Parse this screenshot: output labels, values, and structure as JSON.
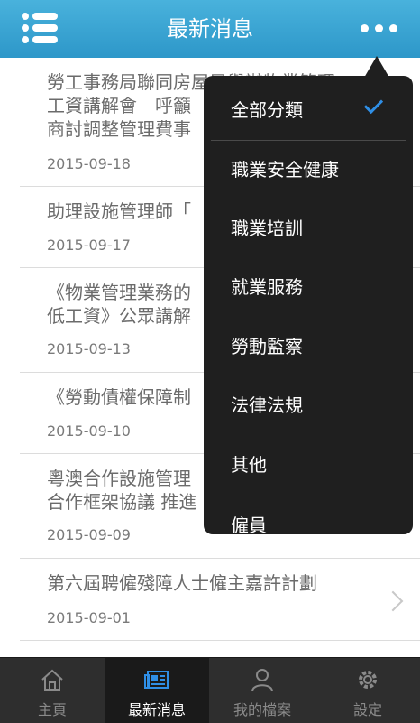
{
  "header": {
    "title": "最新消息",
    "menu_icon": "list-menu-icon",
    "more_icon": "more-dots-icon",
    "color": "#3aa6d6"
  },
  "news": [
    {
      "title": "勞工事務局聯同房屋局舉辦物業管理\n工資講解會　呼籲\n商討調整管理費事",
      "date": "2015-09-18"
    },
    {
      "title": "助理設施管理師「",
      "date": "2015-09-17"
    },
    {
      "title": "《物業管理業務的\n低工資》公眾講解",
      "date": "2015-09-13"
    },
    {
      "title": "《勞動債權保障制",
      "date": "2015-09-10"
    },
    {
      "title": "粵澳合作設施管理\n合作框架協議 推進",
      "date": "2015-09-09"
    },
    {
      "title": "第六屆聘僱殘障人士僱主嘉許計劃",
      "date": "2015-09-01"
    }
  ],
  "dropdown": {
    "items": [
      {
        "label": "全部分類",
        "selected": true
      },
      {
        "label": "職業安全健康",
        "selected": false
      },
      {
        "label": "職業培訓",
        "selected": false
      },
      {
        "label": "就業服務",
        "selected": false
      },
      {
        "label": "勞動監察",
        "selected": false
      },
      {
        "label": "法律法規",
        "selected": false
      },
      {
        "label": "其他",
        "selected": false
      },
      {
        "label": "僱員",
        "selected": false
      }
    ],
    "accent": "#2f8fe6"
  },
  "tabbar": {
    "tabs": [
      {
        "label": "主頁",
        "icon": "home-icon",
        "active": false
      },
      {
        "label": "最新消息",
        "icon": "news-icon",
        "active": true
      },
      {
        "label": "我的檔案",
        "icon": "person-icon",
        "active": false
      },
      {
        "label": "設定",
        "icon": "gear-icon",
        "active": false
      }
    ]
  }
}
